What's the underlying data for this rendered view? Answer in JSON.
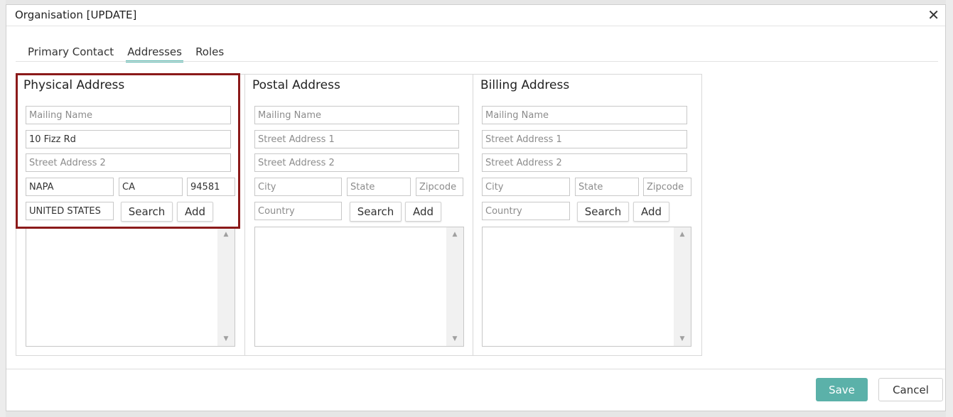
{
  "dialog": {
    "title": "Organisation [UPDATE]",
    "close_icon": "close-icon",
    "close_glyph": "✕"
  },
  "tabs": [
    {
      "label": "Primary Contact",
      "active": false
    },
    {
      "label": "Addresses",
      "active": true
    },
    {
      "label": "Roles",
      "active": false
    }
  ],
  "physical": {
    "title": "Physical Address",
    "mailing_name": {
      "value": "",
      "placeholder": "Mailing Name"
    },
    "street1": {
      "value": "10 Fizz Rd",
      "placeholder": "Street Address 1"
    },
    "street2": {
      "value": "",
      "placeholder": "Street Address 2"
    },
    "city": {
      "value": "NAPA",
      "placeholder": "City"
    },
    "state": {
      "value": "CA",
      "placeholder": "State"
    },
    "zipcode": {
      "value": "94581",
      "placeholder": "Zipcode"
    },
    "country": {
      "value": "UNITED STATES",
      "placeholder": "Country"
    },
    "search_label": "Search",
    "add_label": "Add"
  },
  "postal": {
    "title": "Postal Address",
    "mailing_name": {
      "value": "",
      "placeholder": "Mailing Name"
    },
    "street1": {
      "value": "",
      "placeholder": "Street Address 1"
    },
    "street2": {
      "value": "",
      "placeholder": "Street Address 2"
    },
    "city": {
      "value": "",
      "placeholder": "City"
    },
    "state": {
      "value": "",
      "placeholder": "State"
    },
    "zipcode": {
      "value": "",
      "placeholder": "Zipcode"
    },
    "country": {
      "value": "",
      "placeholder": "Country"
    },
    "search_label": "Search",
    "add_label": "Add"
  },
  "billing": {
    "title": "Billing Address",
    "mailing_name": {
      "value": "",
      "placeholder": "Mailing Name"
    },
    "street1": {
      "value": "",
      "placeholder": "Street Address 1"
    },
    "street2": {
      "value": "",
      "placeholder": "Street Address 2"
    },
    "city": {
      "value": "",
      "placeholder": "City"
    },
    "state": {
      "value": "",
      "placeholder": "State"
    },
    "zipcode": {
      "value": "",
      "placeholder": "Zipcode"
    },
    "country": {
      "value": "",
      "placeholder": "Country"
    },
    "search_label": "Search",
    "add_label": "Add"
  },
  "scrollbar": {
    "up_glyph": "▲",
    "down_glyph": "▼"
  },
  "footer": {
    "save_label": "Save",
    "cancel_label": "Cancel"
  },
  "colors": {
    "accent": "#5bb1a9",
    "highlight_border": "#8b1a1a",
    "tab_underline": "#5bb8b0"
  }
}
